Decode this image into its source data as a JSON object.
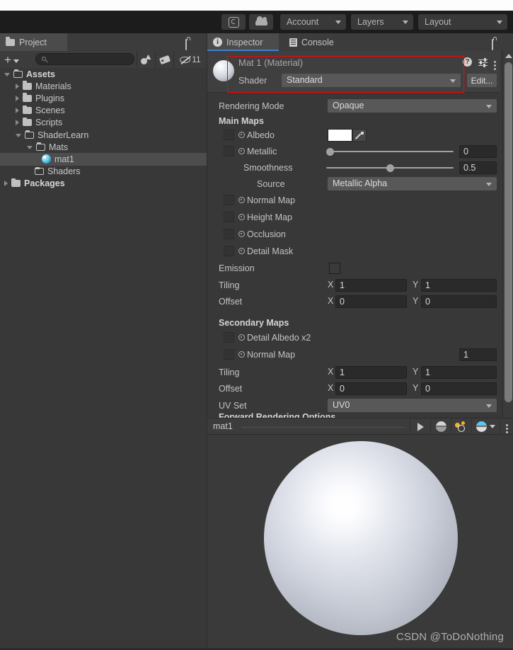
{
  "toolbar": {
    "buttons": [
      {
        "name": "collab-button",
        "icon": "collab-icon",
        "label": ""
      },
      {
        "name": "cloud-button",
        "icon": "cloud-icon",
        "label": ""
      },
      {
        "name": "account-dropdown",
        "icon": "chevron-down-icon",
        "label": "Account"
      },
      {
        "name": "layers-dropdown",
        "icon": "chevron-down-icon",
        "label": "Layers"
      },
      {
        "name": "layout-dropdown",
        "icon": "chevron-down-icon",
        "label": "Layout"
      }
    ]
  },
  "project_panel": {
    "tab_label": "Project",
    "lock_icon": "lock-icon",
    "menu_icon": "kebab-menu-icon",
    "create_label": "+",
    "search_placeholder": "",
    "search_value": "",
    "tool_count": "11",
    "tree": [
      {
        "label": "Assets",
        "depth": 0,
        "twisty": "open",
        "icon": "folder-open-icon",
        "bold": true,
        "selected": false
      },
      {
        "label": "Materials",
        "depth": 1,
        "twisty": "closed",
        "icon": "folder-icon",
        "bold": false,
        "selected": false
      },
      {
        "label": "Plugins",
        "depth": 1,
        "twisty": "closed",
        "icon": "folder-icon",
        "bold": false,
        "selected": false
      },
      {
        "label": "Scenes",
        "depth": 1,
        "twisty": "closed",
        "icon": "folder-icon",
        "bold": false,
        "selected": false
      },
      {
        "label": "Scripts",
        "depth": 1,
        "twisty": "closed",
        "icon": "folder-icon",
        "bold": false,
        "selected": false
      },
      {
        "label": "ShaderLearn",
        "depth": 1,
        "twisty": "open",
        "icon": "folder-open-icon",
        "bold": false,
        "selected": false
      },
      {
        "label": "Mats",
        "depth": 2,
        "twisty": "open",
        "icon": "folder-open-icon",
        "bold": false,
        "selected": false
      },
      {
        "label": "mat1",
        "depth": 3,
        "twisty": "none",
        "icon": "material-icon",
        "bold": false,
        "selected": true
      },
      {
        "label": "Shaders",
        "depth": 2,
        "twisty": "none",
        "icon": "folder-empty-icon",
        "bold": false,
        "selected": false
      },
      {
        "label": "Packages",
        "depth": 0,
        "twisty": "closed",
        "icon": "folder-icon",
        "bold": true,
        "selected": false
      }
    ]
  },
  "inspector": {
    "tabs": [
      {
        "label": "Inspector",
        "icon": "info-icon",
        "active": true
      },
      {
        "label": "Console",
        "icon": "console-icon",
        "active": false
      }
    ],
    "lock_icon": "lock-icon",
    "menu_icon": "kebab-menu-icon",
    "material": {
      "title": "Mat 1 (Material)",
      "shader_label": "Shader",
      "shader_value": "Standard",
      "edit_label": "Edit...",
      "help_icon": "help-icon",
      "preset_icon": "preset-icon",
      "menu_icon": "kebab-menu-icon",
      "highlight_color": "#ff0000"
    },
    "rendering_mode": {
      "label": "Rendering Mode",
      "value": "Opaque"
    },
    "main_maps": {
      "header": "Main Maps",
      "albedo": {
        "label": "Albedo",
        "color": "#ffffff",
        "picker_icon": "eyedropper-icon"
      },
      "metallic": {
        "label": "Metallic",
        "value": "0",
        "slider": 0
      },
      "smoothness": {
        "label": "Smoothness",
        "value": "0.5",
        "slider": 0.5
      },
      "source": {
        "label": "Source",
        "value": "Metallic Alpha"
      },
      "normal_map": {
        "label": "Normal Map"
      },
      "height_map": {
        "label": "Height Map"
      },
      "occlusion": {
        "label": "Occlusion"
      },
      "detail_mask": {
        "label": "Detail Mask"
      },
      "emission": {
        "label": "Emission",
        "color": "#3a3a3a"
      },
      "tiling": {
        "label": "Tiling",
        "x_label": "X",
        "x": "1",
        "y_label": "Y",
        "y": "1"
      },
      "offset": {
        "label": "Offset",
        "x_label": "X",
        "x": "0",
        "y_label": "Y",
        "y": "0"
      }
    },
    "secondary_maps": {
      "header": "Secondary Maps",
      "detail_albedo": {
        "label": "Detail Albedo x2"
      },
      "normal_map": {
        "label": "Normal Map",
        "value": "1"
      },
      "tiling": {
        "label": "Tiling",
        "x_label": "X",
        "x": "1",
        "y_label": "Y",
        "y": "1"
      },
      "offset": {
        "label": "Offset",
        "x_label": "X",
        "x": "0",
        "y_label": "Y",
        "y": "0"
      },
      "uv_set": {
        "label": "UV Set",
        "value": "UV0"
      }
    },
    "forward_rendering": {
      "header": "Forward Rendering Options"
    }
  },
  "preview": {
    "name": "mat1",
    "tools": [
      {
        "name": "play-preview-button",
        "icon": "play-icon"
      },
      {
        "name": "shading-mode-button",
        "icon": "sphere-icon"
      },
      {
        "name": "lighting-button",
        "icon": "lighting-icon"
      },
      {
        "name": "skybox-button",
        "icon": "blue-sphere-icon"
      },
      {
        "name": "preview-menu-button",
        "icon": "kebab-menu-icon"
      }
    ],
    "watermark": "CSDN @ToDoNothing"
  }
}
